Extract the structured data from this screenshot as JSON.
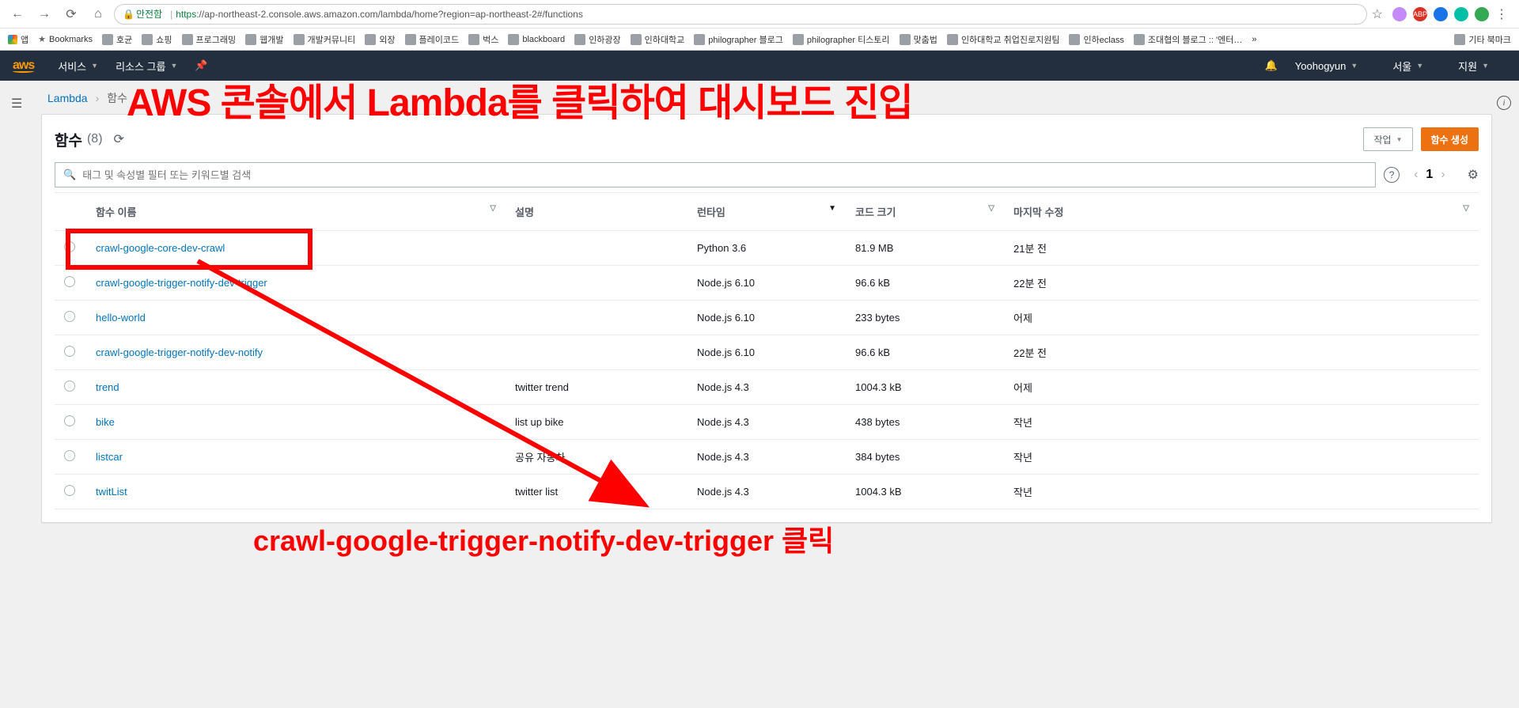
{
  "browser": {
    "secure_label": "안전함",
    "url_proto": "https",
    "url_rest": "://ap-northeast-2.console.aws.amazon.com/lambda/home?region=ap-northeast-2#/functions"
  },
  "bookmarks": {
    "apps": "앱",
    "items": [
      "Bookmarks",
      "호균",
      "쇼핑",
      "프로그래밍",
      "웹개발",
      "개발커뮤니티",
      "외장",
      "플레이코드",
      "벅스",
      "blackboard",
      "인하광장",
      "인하대학교",
      "philographer 블로그",
      "philographer 티스토리",
      "맞춤법",
      "인하대학교 취업진로지원팀",
      "인하eclass",
      "조대협의 블로그 :: '엔터…"
    ],
    "more": "»",
    "other": "기타 북마크"
  },
  "aws_nav": {
    "logo": "aws",
    "services": "서비스",
    "resource_groups": "리소스 그룹",
    "user": "Yoohogyun",
    "region": "서울",
    "support": "지원"
  },
  "breadcrumb": {
    "root": "Lambda",
    "current": "함수"
  },
  "panel": {
    "title": "함수",
    "count": "(8)",
    "actions": "작업",
    "create": "함수 생성",
    "search_placeholder": "태그 및 속성별 필터 또는 키워드별 검색",
    "page": "1"
  },
  "columns": {
    "name": "함수 이름",
    "desc": "설명",
    "runtime": "런타임",
    "size": "코드 크기",
    "modified": "마지막 수정"
  },
  "rows": [
    {
      "name": "crawl-google-core-dev-crawl",
      "desc": "",
      "runtime": "Python 3.6",
      "size": "81.9 MB",
      "modified": "21분 전"
    },
    {
      "name": "crawl-google-trigger-notify-dev-trigger",
      "desc": "",
      "runtime": "Node.js 6.10",
      "size": "96.6 kB",
      "modified": "22분 전"
    },
    {
      "name": "hello-world",
      "desc": "",
      "runtime": "Node.js 6.10",
      "size": "233 bytes",
      "modified": "어제"
    },
    {
      "name": "crawl-google-trigger-notify-dev-notify",
      "desc": "",
      "runtime": "Node.js 6.10",
      "size": "96.6 kB",
      "modified": "22분 전"
    },
    {
      "name": "trend",
      "desc": "twitter trend",
      "runtime": "Node.js 4.3",
      "size": "1004.3 kB",
      "modified": "어제"
    },
    {
      "name": "bike",
      "desc": "list up bike",
      "runtime": "Node.js 4.3",
      "size": "438 bytes",
      "modified": "작년"
    },
    {
      "name": "listcar",
      "desc": "공유 자동차",
      "runtime": "Node.js 4.3",
      "size": "384 bytes",
      "modified": "작년"
    },
    {
      "name": "twitList",
      "desc": "twitter list",
      "runtime": "Node.js 4.3",
      "size": "1004.3 kB",
      "modified": "작년"
    }
  ],
  "annotation": {
    "title": "AWS 콘솔에서 Lambda를 클릭하여 대시보드 진입",
    "text": "crawl-google-trigger-notify-dev-trigger 클릭"
  }
}
